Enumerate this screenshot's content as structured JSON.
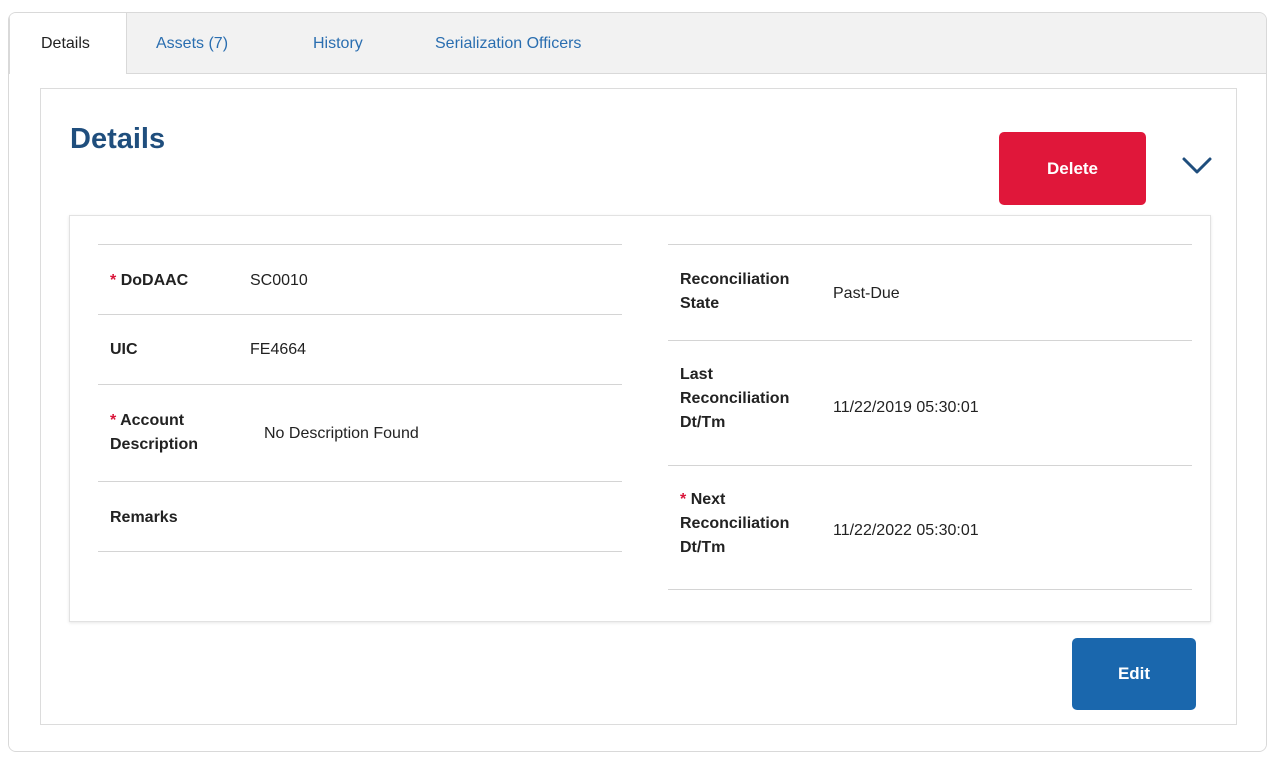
{
  "tabs": [
    {
      "label": "Details",
      "active": true
    },
    {
      "label": "Assets (7)",
      "active": false
    },
    {
      "label": "History",
      "active": false
    },
    {
      "label": "Serialization Officers",
      "active": false
    }
  ],
  "card": {
    "title": "Details",
    "delete_label": "Delete",
    "edit_label": "Edit",
    "collapse_icon": "chevron-down-icon"
  },
  "colors": {
    "title": "#1f4e7d",
    "delete": "#e0173a",
    "edit": "#1a67ad",
    "tab_link": "#2a6eb0",
    "required": "#d9163a"
  },
  "left_fields": {
    "dodaac": {
      "required_mark": "*",
      "label": "DoDAAC",
      "value": "SC0010"
    },
    "uic": {
      "label": "UIC",
      "value": "FE4664"
    },
    "account_description": {
      "required_mark": "*",
      "label_line1": "Account",
      "label_line2": "Description",
      "value": "No Description Found"
    },
    "remarks": {
      "label": "Remarks",
      "value": ""
    }
  },
  "right_fields": {
    "reconciliation_state": {
      "label_line1": "Reconciliation",
      "label_line2": "State",
      "value": "Past-Due"
    },
    "last_reconciliation": {
      "label_line1": "Last",
      "label_line2": "Reconciliation",
      "label_line3": "Dt/Tm",
      "value": "11/22/2019 05:30:01"
    },
    "next_reconciliation": {
      "required_mark": "*",
      "label_line1": "Next",
      "label_line2": "Reconciliation",
      "label_line3": "Dt/Tm",
      "value": "11/22/2022 05:30:01"
    }
  }
}
